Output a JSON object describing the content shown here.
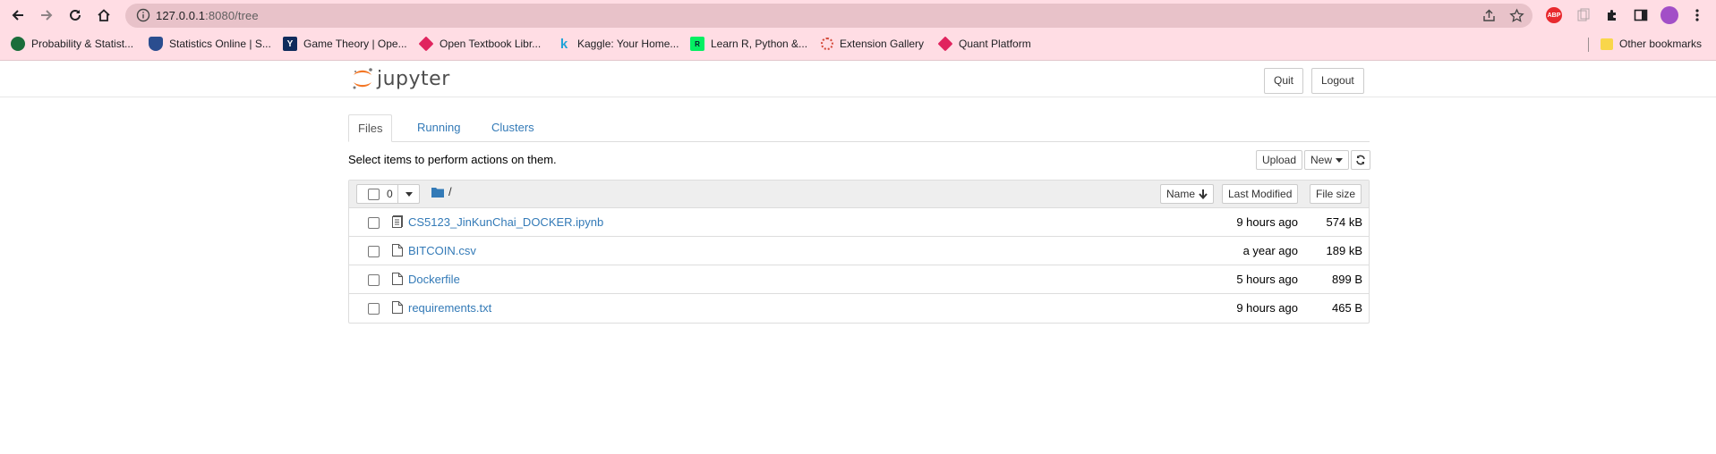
{
  "browser": {
    "url_host": "127.0.0.1",
    "url_rest": ":8080/tree",
    "bookmarks": [
      {
        "label": "Probability & Statist...",
        "icon": "globe-icon",
        "color": "#1a6d3a"
      },
      {
        "label": "Statistics Online | S...",
        "icon": "shield-icon",
        "color": "#2a4d8f"
      },
      {
        "label": "Game Theory | Ope...",
        "icon": "yale-icon",
        "color": "#0f2b5c"
      },
      {
        "label": "Open Textbook Libr...",
        "icon": "otl-icon",
        "color": "#e0245e"
      },
      {
        "label": "Kaggle: Your Home...",
        "icon": "kaggle-icon",
        "color": "#1fa3d8"
      },
      {
        "label": "Learn R, Python &...",
        "icon": "datacamp-icon",
        "color": "#03ef62"
      },
      {
        "label": "Extension Gallery",
        "icon": "extension-gallery-icon",
        "color": "#d44a3a"
      },
      {
        "label": "Quant Platform",
        "icon": "quant-icon",
        "color": "#e0245e"
      }
    ],
    "other_bookmarks": "Other bookmarks"
  },
  "header": {
    "logo_text": "jupyter",
    "quit_label": "Quit",
    "logout_label": "Logout"
  },
  "tabs": [
    {
      "label": "Files",
      "active": true
    },
    {
      "label": "Running",
      "active": false
    },
    {
      "label": "Clusters",
      "active": false
    }
  ],
  "toolbar": {
    "notice": "Select items to perform actions on them.",
    "upload_label": "Upload",
    "new_label": "New",
    "refresh_icon": "refresh-icon"
  },
  "list": {
    "selected_count": "0",
    "breadcrumb": "/",
    "sort_name": "Name",
    "sort_modified": "Last Modified",
    "sort_size": "File size",
    "files": [
      {
        "name": "CS5123_JinKunChai_DOCKER.ipynb",
        "type": "notebook",
        "modified": "9 hours ago",
        "size": "574 kB"
      },
      {
        "name": "BITCOIN.csv",
        "type": "file",
        "modified": "a year ago",
        "size": "189 kB"
      },
      {
        "name": "Dockerfile",
        "type": "file",
        "modified": "5 hours ago",
        "size": "899 B"
      },
      {
        "name": "requirements.txt",
        "type": "file",
        "modified": "9 hours ago",
        "size": "465 B"
      }
    ]
  },
  "colors": {
    "chrome_bg": "#ffdde4",
    "link": "#337ab7",
    "jupyter_orange": "#f37726"
  }
}
